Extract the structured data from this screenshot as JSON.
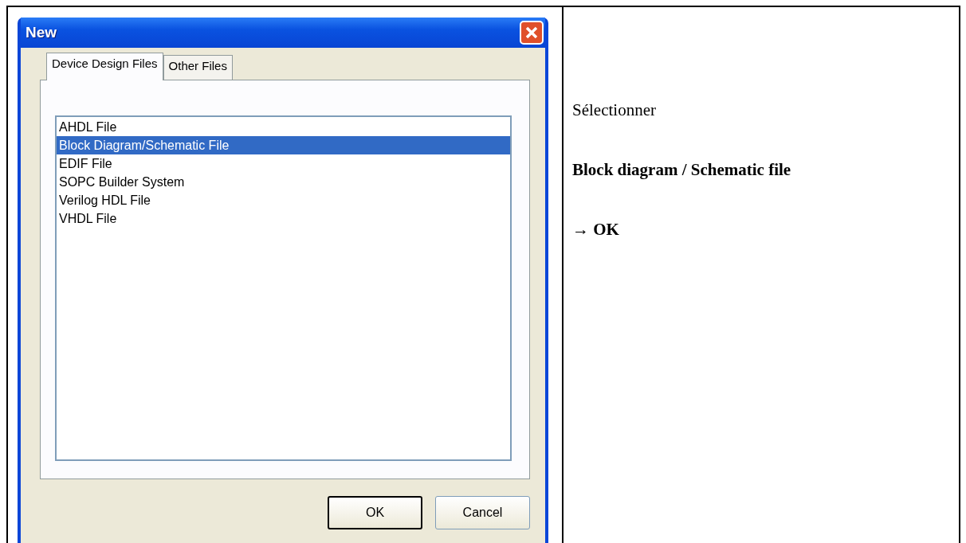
{
  "dialog": {
    "title": "New",
    "tabs": [
      {
        "label": "Device Design Files",
        "selected": true
      },
      {
        "label": "Other Files",
        "selected": false
      }
    ],
    "file_types": [
      {
        "label": "AHDL File",
        "selected": false
      },
      {
        "label": "Block Diagram/Schematic File",
        "selected": true
      },
      {
        "label": "EDIF File",
        "selected": false
      },
      {
        "label": "SOPC Builder System",
        "selected": false
      },
      {
        "label": "Verilog HDL File",
        "selected": false
      },
      {
        "label": "VHDL File",
        "selected": false
      }
    ],
    "buttons": [
      {
        "label": "OK",
        "default": true
      },
      {
        "label": "Cancel",
        "default": false
      }
    ]
  },
  "instructions": [
    {
      "text": "Sélectionner",
      "bold": false
    },
    {
      "text": "Block diagram / Schematic file",
      "bold": true
    },
    {
      "text": "→ OK",
      "bold": true
    }
  ]
}
